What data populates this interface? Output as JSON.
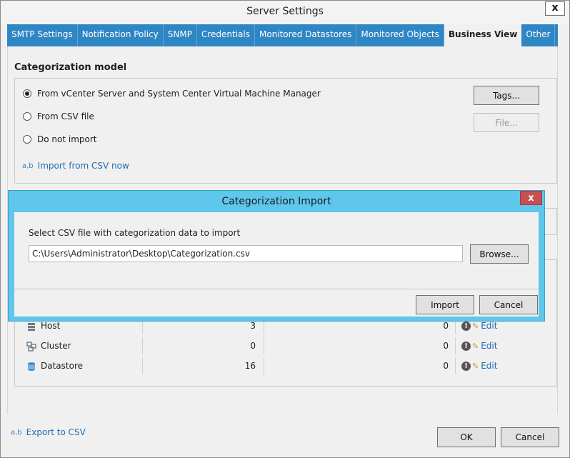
{
  "window": {
    "title": "Server Settings",
    "close_glyph": "x"
  },
  "tabs": [
    {
      "label": "SMTP Settings",
      "active": false
    },
    {
      "label": "Notification Policy",
      "active": false
    },
    {
      "label": "SNMP",
      "active": false
    },
    {
      "label": "Credentials",
      "active": false
    },
    {
      "label": "Monitored Datastores",
      "active": false
    },
    {
      "label": "Monitored Objects",
      "active": false
    },
    {
      "label": "Business View",
      "active": true
    },
    {
      "label": "Other",
      "active": false
    }
  ],
  "categorization": {
    "title": "Categorization model",
    "options": [
      {
        "label": "From vCenter Server and System Center Virtual Machine Manager",
        "checked": true
      },
      {
        "label": "From CSV file",
        "checked": false
      },
      {
        "label": "Do not import",
        "checked": false
      }
    ],
    "tags_button": "Tags...",
    "file_button": "File...",
    "import_link": "Import from CSV now",
    "csv_icon": "a,b"
  },
  "objects_table": {
    "rows": [
      {
        "name": "Host",
        "icon": "host-icon",
        "count": "3",
        "second": "0",
        "action": "Edit"
      },
      {
        "name": "Cluster",
        "icon": "cluster-icon",
        "count": "0",
        "second": "0",
        "action": "Edit"
      },
      {
        "name": "Datastore",
        "icon": "datastore-icon",
        "count": "16",
        "second": "0",
        "action": "Edit"
      }
    ]
  },
  "footer": {
    "export_link": "Export to CSV",
    "csv_icon": "a,b",
    "ok_button": "OK",
    "cancel_button": "Cancel"
  },
  "dialog": {
    "title": "Categorization Import",
    "close_glyph": "x",
    "prompt": "Select CSV file with categorization data to import",
    "path_value": "C:\\Users\\Administrator\\Desktop\\Categorization.csv",
    "browse_button": "Browse...",
    "import_button": "Import",
    "cancel_button": "Cancel"
  },
  "colors": {
    "tab_bar": "#2f86c4",
    "dialog_frame": "#5ec7eb",
    "dialog_close": "#c75050",
    "link": "#1f6cb5"
  }
}
